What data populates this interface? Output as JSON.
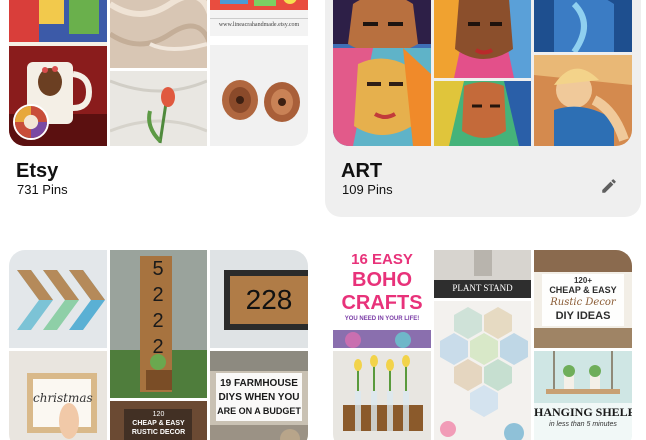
{
  "boards": [
    {
      "name": "Etsy",
      "pin_count": "731 Pins",
      "tile_texts": {
        "shop_url": "www.lineacrahandmade.etsy.com"
      }
    },
    {
      "name": "ART",
      "pin_count": "109 Pins",
      "edit_icon": "pencil-icon"
    },
    {
      "tile_texts": {
        "house_number_vertical": [
          "5",
          "2",
          "2",
          "2"
        ],
        "house_number": "228",
        "christmas_sign": "christmas",
        "farmhouse": [
          "19 FARMHOUSE",
          "DIYS WHEN YOU",
          "ARE ON A BUDGET"
        ],
        "rustic_decor": [
          "120",
          "CHEAP & EASY",
          "RUSTIC DECOR"
        ]
      }
    },
    {
      "tile_texts": {
        "boho": [
          "16 EASY",
          "BOHO",
          "CRAFTS",
          "YOU NEED IN YOUR LIFE!"
        ],
        "plant_stand": "PLANT STAND",
        "rustic_diy": [
          "120+",
          "CHEAP & EASY",
          "Rustic Decor",
          "DIY IDEAS"
        ],
        "hanging_shelf": [
          "HANGING SHELF",
          "in less than 5 minutes"
        ]
      }
    }
  ],
  "colors": {
    "hover_background": "#efefef",
    "text": "#111111",
    "icon_gray": "#5f5f5f",
    "boho_pink": "#e8327a",
    "boho_purple": "#7a3ba6"
  }
}
